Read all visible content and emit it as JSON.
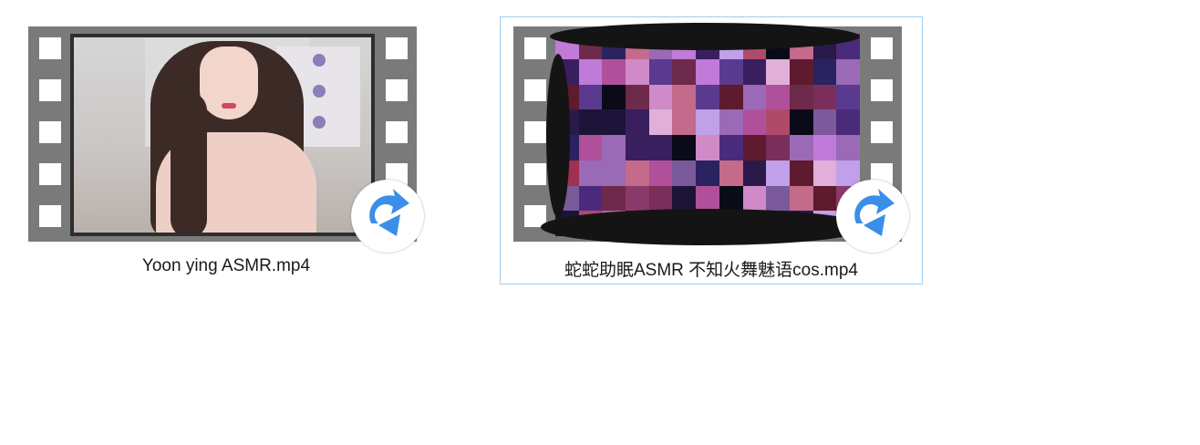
{
  "files": [
    {
      "name": "Yoon ying ASMR.mp4",
      "selected": false,
      "icon": "video-file-icon",
      "overlay_icon": "shortcut-arrow-icon"
    },
    {
      "name": "蛇蛇助眠ASMR 不知火舞魅语cos.mp4",
      "selected": true,
      "icon": "video-file-icon",
      "overlay_icon": "shortcut-arrow-icon"
    }
  ],
  "colors": {
    "film_strip": "#7a7a7a",
    "selection_border": "#9fcdee",
    "arrow_blue": "#3b8fe8"
  }
}
